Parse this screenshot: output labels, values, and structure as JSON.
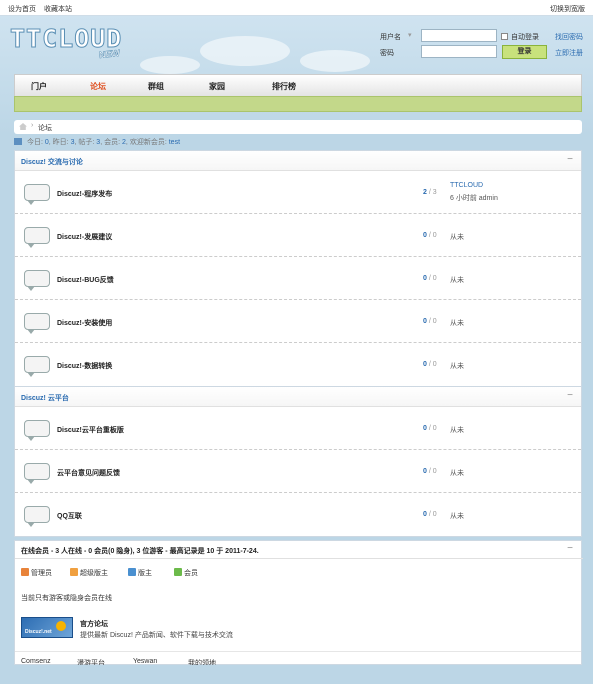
{
  "topbar": {
    "set_home": "设为首页",
    "bookmark": "收藏本站",
    "switch_width": "切换到宽版"
  },
  "logo": {
    "text": "TTCLOUD",
    "sub": "NEW"
  },
  "login": {
    "username_label": "用户名",
    "password_label": "密码",
    "username_value": "",
    "password_value": "",
    "auto_login": "自动登录",
    "find_password": "找回密码",
    "login_button": "登录",
    "register": "立即注册"
  },
  "nav": [
    {
      "label": "门户",
      "active": false
    },
    {
      "label": "论坛",
      "active": true
    },
    {
      "label": "群组",
      "active": false
    },
    {
      "label": "家园",
      "active": false
    },
    {
      "label": "排行榜",
      "active": false
    }
  ],
  "breadcrumb": {
    "sep": "›",
    "current": "论坛"
  },
  "stats": {
    "today_label": "今日:",
    "today": "0",
    "yesterday_label": "昨日:",
    "yesterday": "3",
    "posts_label": "帖子:",
    "posts": "3",
    "members_label": "会员:",
    "members": "2",
    "welcome_label": "欢迎新会员:",
    "welcome_user": "test"
  },
  "sections": [
    {
      "title": "Discuz! 交流与讨论",
      "collapse": "−",
      "forums": [
        {
          "name": "Discuz!-程序发布",
          "threads": "2",
          "posts": "3",
          "last": "",
          "last_title": "TTCLOUD",
          "last_time": "6 小时前 admin"
        },
        {
          "name": "Discuz!-发展建议",
          "threads": "0",
          "posts": "0",
          "last": "从未"
        },
        {
          "name": "Discuz!-BUG反馈",
          "threads": "0",
          "posts": "0",
          "last": "从未"
        },
        {
          "name": "Discuz!-安装使用",
          "threads": "0",
          "posts": "0",
          "last": "从未"
        },
        {
          "name": "Discuz!-数据转换",
          "threads": "0",
          "posts": "0",
          "last": "从未"
        }
      ]
    },
    {
      "title": "Discuz! 云平台",
      "collapse": "−",
      "forums": [
        {
          "name": "Discuz!云平台重板版",
          "threads": "0",
          "posts": "0",
          "last": "从未"
        },
        {
          "name": "云平台意见问题反馈",
          "threads": "0",
          "posts": "0",
          "last": "从未"
        },
        {
          "name": "QQ互联",
          "threads": "0",
          "posts": "0",
          "last": "从未"
        }
      ]
    }
  ],
  "online": {
    "header": "在线会员 - 3 人在线 - 0 会员(0 隐身), 3 位游客 - 最高记录是 10 于 2011-7-24.",
    "collapse": "−",
    "legend": [
      {
        "label": "管理员",
        "color": "#e8833a"
      },
      {
        "label": "超级版主",
        "color": "#f0a040"
      },
      {
        "label": "版主",
        "color": "#4a90d0"
      },
      {
        "label": "会员",
        "color": "#6cba4a"
      }
    ],
    "note": "当前只有游客或隐身会员在线",
    "banner_text": "Discuz!.net",
    "official_title": "官方论坛",
    "official_desc": "提供最新 Discuz! 产品新闻、软件下载与技术交流",
    "links": [
      "Comsenz",
      "漫游平台",
      "Yeswan",
      "我的领地"
    ]
  },
  "colors": {
    "accent": "#2a6bb0",
    "nav_active": "#e05020",
    "green_bar": "#c3d88a",
    "background": "#bcd6e6"
  }
}
